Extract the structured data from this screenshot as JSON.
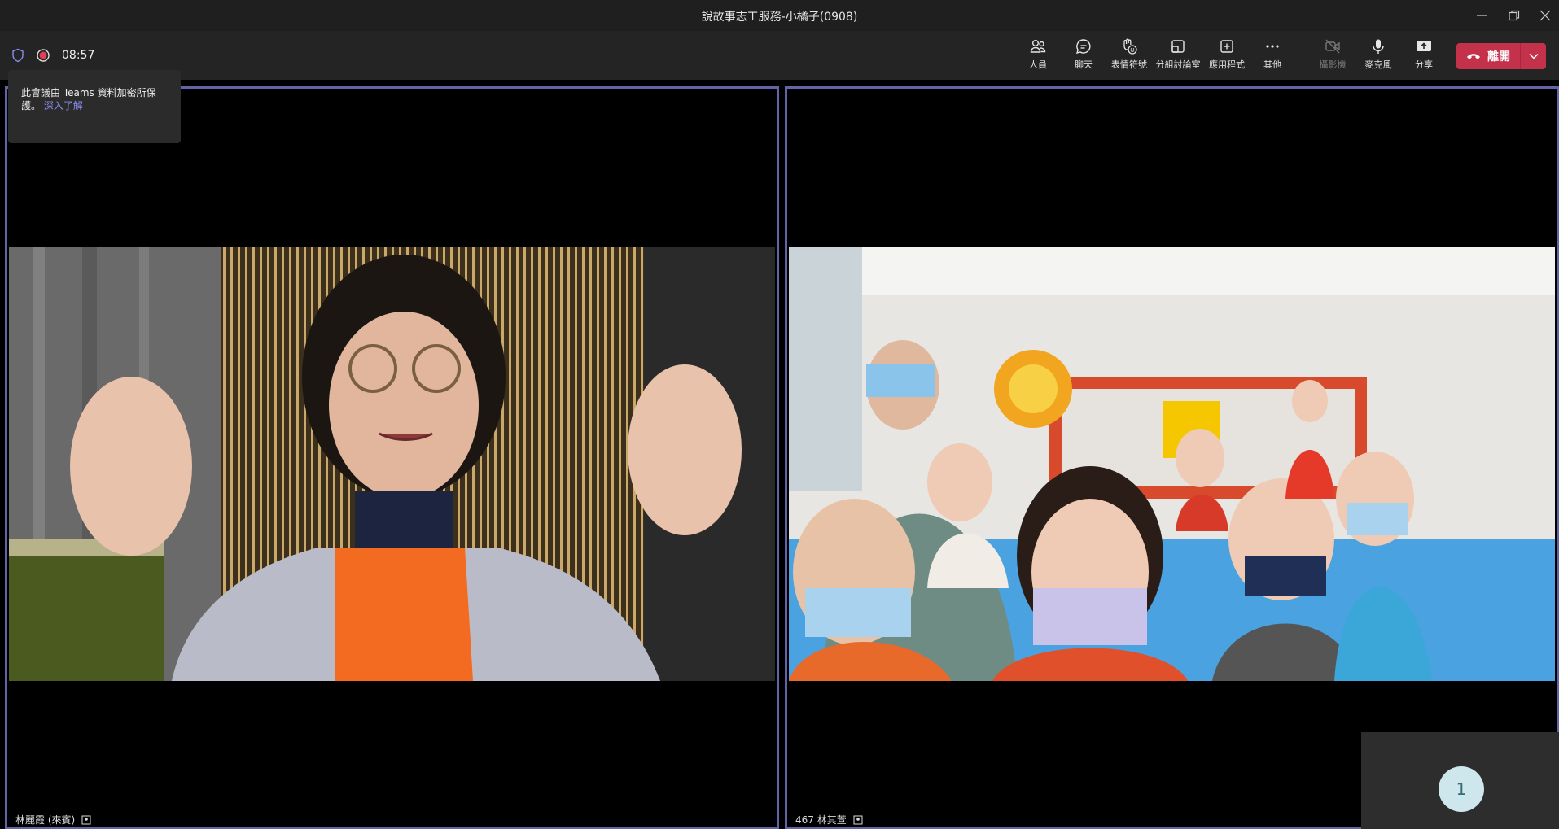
{
  "window": {
    "title": "說故事志工服務-小橘子(0908)"
  },
  "toolbar": {
    "timer": "08:57",
    "buttons": {
      "people": "人員",
      "chat": "聊天",
      "reactions": "表情符號",
      "rooms": "分組討論室",
      "apps": "應用程式",
      "more": "其他",
      "camera": "攝影機",
      "mic": "麥克風",
      "share": "分享"
    },
    "leave_label": "離開"
  },
  "tooltip": {
    "text": "此會議由 Teams 資料加密所保護。",
    "link": "深入了解"
  },
  "participants": {
    "left_name": "林麗霞 (來賓)",
    "right_name": "467 林其萱"
  },
  "self_view": {
    "initial": "1"
  },
  "colors": {
    "accent": "#6264a7",
    "leave": "#c4314b",
    "link": "#8b8cf0"
  }
}
